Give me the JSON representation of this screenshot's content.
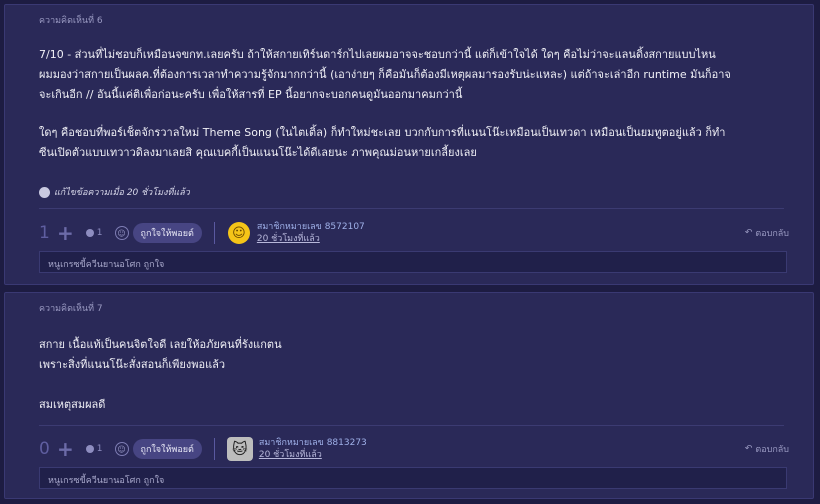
{
  "comments": [
    {
      "header": "ความคิดเห็นที่ 6",
      "paragraph1": [
        "7/10 - ส่วนที่ไม่ชอบก็เหมือนจขกท.เลยครับ ถ้าให้สกายเทิร์นดาร์กไปเลยผมอาจจะชอบกว่านี้ แต่ก็เข้าใจได้ ใดๆ คือไม่ว่าจะแลนดิ้งสกายแบบไหน",
        "ผมมองว่าสกายเป็นผลค.ที่ต้องการเวลาทำความรู้จักมากกว่านี้ (เอาง่ายๆ ก็คือมันก็ต้องมีเหตุผลมารองรับน่ะแหละ) แต่ถ้าจะเล่าอีก runtime มันก็อาจ",
        "จะเกินอีก // อันนี้แค่ติเพื่อก่อนะครับ เพื่อให้สารที่ EP นี้อยากจะบอกคนดูมันออกมาคมกว่านี้"
      ],
      "paragraph2": [
        "ใดๆ คือชอบที่พอร์เช็ตจักรวาลใหม่ Theme Song (ในไตเติ้ล) ก็ทำใหม่ชะเลย บวกกับการที่แนนโน๊ะเหมือนเป็นเทวดา เหมือนเป็นยมทูตอยู่แล้ว ก็ทำ",
        "ซีนเปิดตัวแบบเทวาวดิลงมาเลยสิ คุณเบคกี้เป็นแนนโน๊ะได้ดีเลยนะ ภาพคุณม่อนหายเกลี้ยงเลย"
      ],
      "edited": "แก้ไขข้อความเมื่อ 20 ชั่วโมงที่แล้ว",
      "score": "1",
      "mini_count": "1",
      "like_label": "ถูกใจให้พอยต์",
      "member": "สมาชิกหมายเลข 8572107",
      "time": "20 ชั่วโมงที่แล้ว",
      "avatar_icon": "smiley-face-icon",
      "reply_label": "ตอบกลับ",
      "reply_box": "หนูเกรซขี้ควีนยานอโศก ถูกใจ"
    },
    {
      "header": "ความคิดเห็นที่ 7",
      "paragraph1": [
        "สกาย เนื้อแท้เป็นคนจิตใจดี เลยให้อภัยคนที่รังแกตน",
        "เพราะสิ่งที่แนนโน๊ะสั่งสอนก็เพียงพอแล้ว"
      ],
      "paragraph2": [
        "สมเหตุสมผลดี"
      ],
      "score": "0",
      "mini_count": "1",
      "like_label": "ถูกใจให้พอยต์",
      "member": "สมาชิกหมายเลข 8813273",
      "time": "20 ชั่วโมงที่แล้ว",
      "avatar_icon": "cat-photo-icon",
      "reply_label": "ตอบกลับ",
      "reply_box": "หนูเกรซขี้ควีนยานอโศก ถูกใจ"
    }
  ]
}
